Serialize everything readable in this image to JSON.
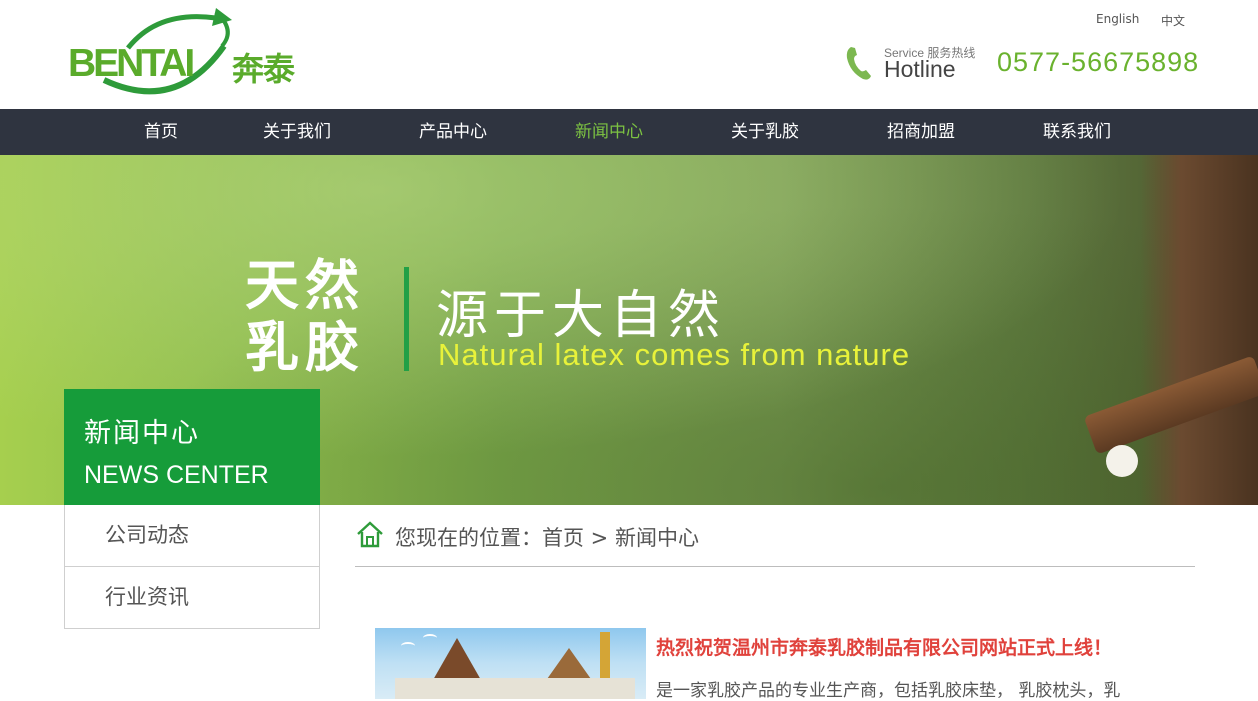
{
  "header": {
    "logo_text": "BENTAI",
    "logo_cn": "奔泰",
    "lang_en": "English",
    "lang_cn": "中文",
    "hotline_sub": "Service 服务热线",
    "hotline_title": "Hotline",
    "hotline_number": "0577-56675898"
  },
  "nav": {
    "items": [
      "首页",
      "关于我们",
      "产品中心",
      "新闻中心",
      "关于乳胶",
      "招商加盟",
      "联系我们"
    ],
    "active_index": 3
  },
  "banner": {
    "big_line1": "天然",
    "big_line2": "乳胶",
    "slogan_cn": "源于大自然",
    "slogan_en": "Natural latex comes from nature"
  },
  "sidebar": {
    "title_cn": "新闻中心",
    "title_en": "NEWS CENTER",
    "items": [
      "公司动态",
      "行业资讯"
    ]
  },
  "breadcrumb": {
    "prefix": "您现在的位置：",
    "home": "首页",
    "separator": " > ",
    "current": "新闻中心"
  },
  "news": {
    "title": "热烈祝贺温州市奔泰乳胶制品有限公司网站正式上线！",
    "excerpt": "是一家乳胶产品的专业生产商，包括乳胶床垫， 乳胶枕头，乳"
  },
  "colors": {
    "brand_green": "#5aab2b",
    "nav_bg": "#2f3440",
    "nav_active": "#7cc242",
    "side_title_bg": "#169c3a",
    "news_title": "#e0423c",
    "slogan_en": "#e8f23a"
  }
}
